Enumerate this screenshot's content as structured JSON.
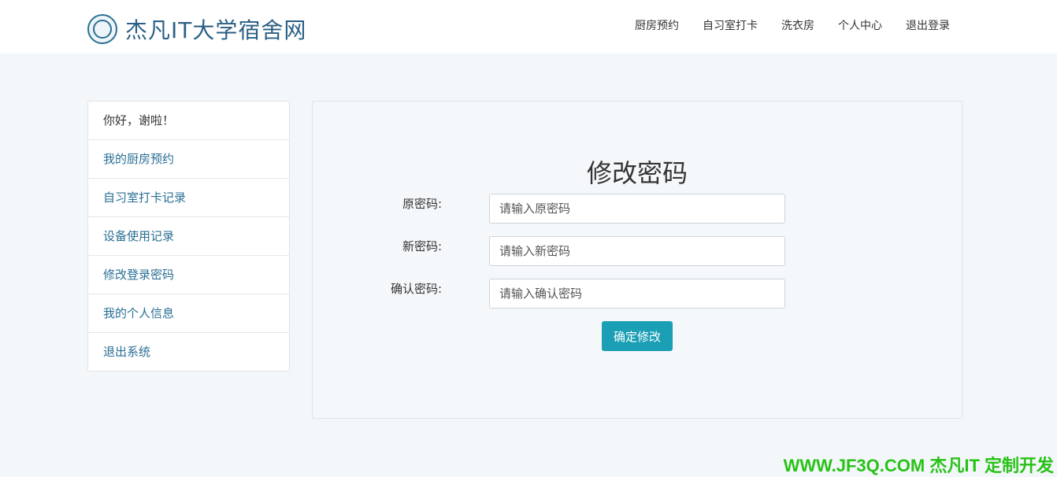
{
  "header": {
    "site_name": "杰凡IT大学宿舍网",
    "nav": [
      "厨房预约",
      "自习室打卡",
      "洗衣房",
      "个人中心",
      "退出登录"
    ]
  },
  "sidebar": {
    "greeting": "你好，谢啦！",
    "items": [
      "我的厨房预约",
      "自习室打卡记录",
      "设备使用记录",
      "修改登录密码",
      "我的个人信息",
      "退出系统"
    ]
  },
  "form": {
    "title": "修改密码",
    "fields": [
      {
        "label": "原密码:",
        "placeholder": "请输入原密码"
      },
      {
        "label": "新密码:",
        "placeholder": "请输入新密码"
      },
      {
        "label": "确认密码:",
        "placeholder": "请输入确认密码"
      }
    ],
    "submit_label": "确定修改"
  },
  "watermark": "WWW.JF3Q.COM 杰凡IT  定制开发",
  "colors": {
    "accent": "#1a9fb5",
    "brand": "#2a5f85",
    "link": "#2a6f95",
    "watermark": "#28c218"
  }
}
